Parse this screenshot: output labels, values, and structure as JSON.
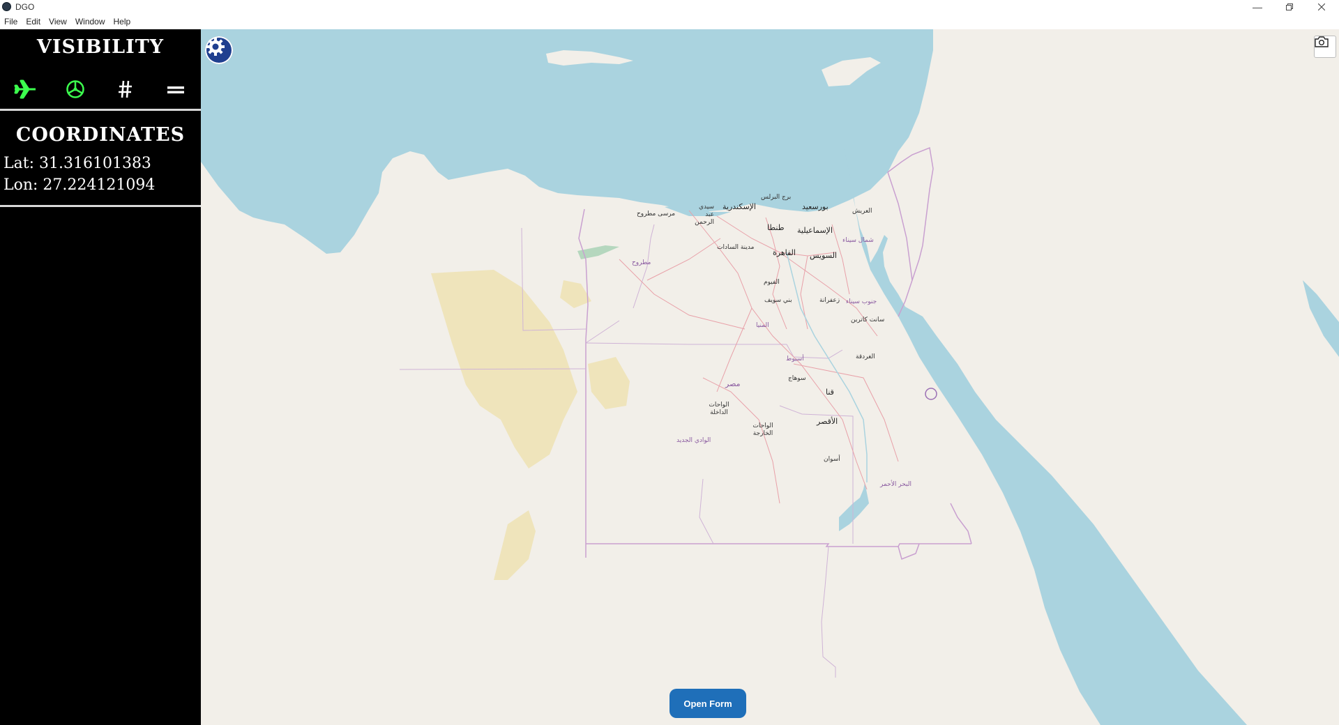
{
  "window": {
    "title": "DGO",
    "icon": "app-globe-icon",
    "controls": [
      "minimize-icon",
      "restore-icon",
      "close-icon"
    ]
  },
  "menu": {
    "items": [
      {
        "label": "File"
      },
      {
        "label": "Edit"
      },
      {
        "label": "View"
      },
      {
        "label": "Window"
      },
      {
        "label": "Help"
      }
    ]
  },
  "panel": {
    "visibility_title": "VISIBILITY",
    "visibility_icons": [
      "airplane-icon",
      "radar-icon",
      "hash-icon",
      "equals-icon"
    ],
    "accent_color": "#3cff4e",
    "coordinates_title": "COORDINATES",
    "lat_text": "Lat: 31.316101383",
    "lon_text": "Lon: 27.224121094"
  },
  "map": {
    "settings_icon": "gear-icon",
    "camera_icon": "camera-icon",
    "open_form_label": "Open Form",
    "sea_color": "#aad3df",
    "land_color": "#f2efe9",
    "labels": [
      {
        "text": "برج البرلس"
      },
      {
        "text": "بورسعيد"
      },
      {
        "text": "العريش"
      },
      {
        "text": "سيدي عبد الرحمن"
      },
      {
        "text": "الإسكندرية"
      },
      {
        "text": "مرسى مطروح"
      },
      {
        "text": "طنطا"
      },
      {
        "text": "الإسماعيلية"
      },
      {
        "text": "شمال سيناء"
      },
      {
        "text": "مدينة السادات"
      },
      {
        "text": "القاهرة"
      },
      {
        "text": "السويس"
      },
      {
        "text": "مطروح"
      },
      {
        "text": "الفيوم"
      },
      {
        "text": "بني سويف"
      },
      {
        "text": "زعفرانة"
      },
      {
        "text": "جنوب سيناء"
      },
      {
        "text": "سانت كاترين"
      },
      {
        "text": "المنيا"
      },
      {
        "text": "الغردقة"
      },
      {
        "text": "أسيوط"
      },
      {
        "text": "مصر"
      },
      {
        "text": "سوهاج"
      },
      {
        "text": "قنا"
      },
      {
        "text": "الواحات الداخلة"
      },
      {
        "text": "الأقصر"
      },
      {
        "text": "الواحات الخارجة"
      },
      {
        "text": "الوادي الجديد"
      },
      {
        "text": "أسوان"
      },
      {
        "text": "البحر الأحمر"
      }
    ]
  }
}
